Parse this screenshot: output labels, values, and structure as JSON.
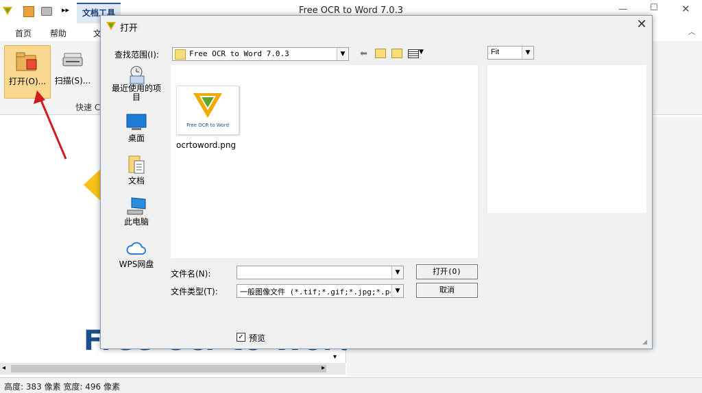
{
  "app": {
    "title": "Free OCR to Word 7.0.3",
    "contextual_tab": "文档工具",
    "tabs": [
      "首页",
      "帮助",
      "文"
    ],
    "window_controls": [
      "minimize",
      "maximize",
      "close"
    ]
  },
  "ribbon": {
    "open_label": "打开(O)...",
    "scan_label": "扫描(S)...",
    "group_label": "快速 C"
  },
  "status": {
    "text": "高度: 383 像素  宽度: 496 像素"
  },
  "watermark": {
    "text": "Free Ocr to Word"
  },
  "dialog": {
    "title": "打开",
    "lookin_label": "查找范围(I):",
    "lookin_value": "Free OCR to Word 7.0.3",
    "zoom_value": "Fit",
    "places": [
      {
        "label": "最近使用的项目",
        "icon": "recent-icon"
      },
      {
        "label": "桌面",
        "icon": "desktop-icon"
      },
      {
        "label": "文档",
        "icon": "documents-icon"
      },
      {
        "label": "此电脑",
        "icon": "computer-icon"
      },
      {
        "label": "WPS网盘",
        "icon": "cloud-icon"
      }
    ],
    "file": {
      "name": "ocrtoword.png",
      "thumb_caption": "Free OCR to Word"
    },
    "filename_label": "文件名(N):",
    "filename_value": "",
    "filetype_label": "文件类型(T):",
    "filetype_value": "一般图像文件 (*.tif;*.gif;*.jpg;*.pcx",
    "open_button": "打开(O)",
    "cancel_button": "取消",
    "preview_label": "预览",
    "preview_checked": true
  },
  "colors": {
    "accent": "#2b5797",
    "open_highlight": "#fbd88f",
    "arrow": "#d01c1c"
  }
}
